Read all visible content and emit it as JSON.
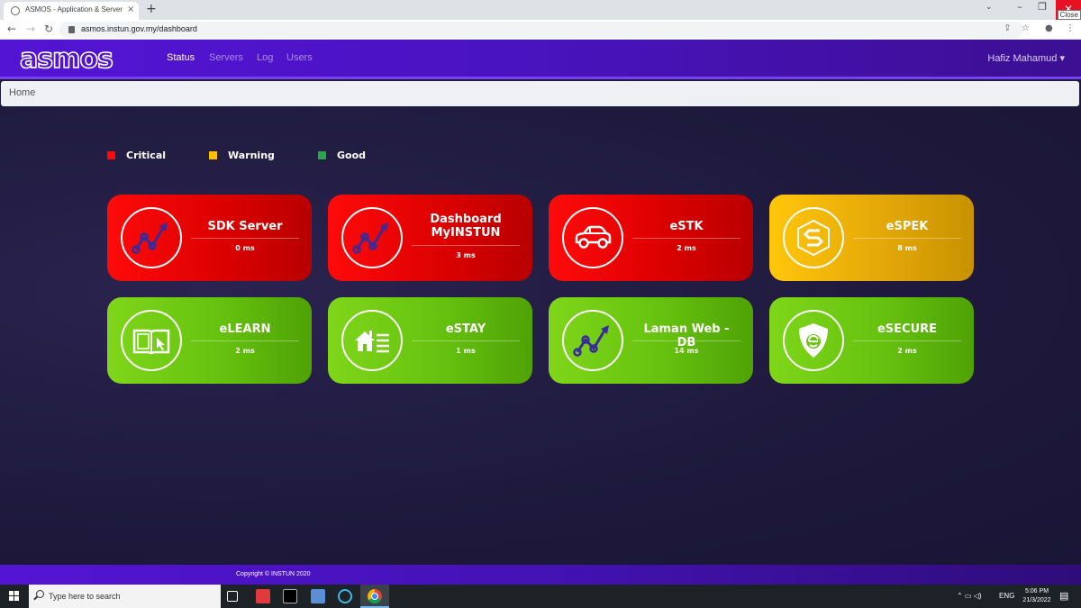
{
  "browser": {
    "tab_title": "ASMOS - Application & Server M",
    "tab_close": "×",
    "new_tab": "+",
    "url": "asmos.instun.gov.my/dashboard",
    "close_tooltip": "Close",
    "back": "←",
    "forward": "→",
    "reload": "↻",
    "minimize": "–",
    "restore": "❐",
    "close": "✕",
    "tab_list": "⌄",
    "share": "⇪",
    "star": "☆",
    "profile": "●",
    "menu": "⋮"
  },
  "navbar": {
    "logo": "asmos",
    "links": [
      "Status",
      "Servers",
      "Log",
      "Users"
    ],
    "active": "Status",
    "user": "Hafiz Mahamud ▾"
  },
  "breadcrumb": "Home",
  "legend": [
    {
      "label": "Critical",
      "color": "#ff0a0a"
    },
    {
      "label": "Warning",
      "color": "#ffbf00"
    },
    {
      "label": "Good",
      "color": "#27a745"
    }
  ],
  "cards": [
    {
      "name": "SDK Server",
      "ms": "0 ms",
      "status": "critical",
      "icon": "trend-chart-icon"
    },
    {
      "name": "Dashboard MyINSTUN",
      "ms": "3 ms",
      "status": "critical",
      "icon": "trend-chart-icon"
    },
    {
      "name": "eSTK",
      "ms": "2 ms",
      "status": "critical",
      "icon": "car-icon"
    },
    {
      "name": "eSPEK",
      "ms": "8 ms",
      "status": "warning",
      "icon": "s-hexagon-icon"
    },
    {
      "name": "eLEARN",
      "ms": "2 ms",
      "status": "good",
      "icon": "book-icon"
    },
    {
      "name": "eSTAY",
      "ms": "1 ms",
      "status": "good",
      "icon": "house-list-icon"
    },
    {
      "name": "Laman Web - DB",
      "ms": "14 ms",
      "status": "good",
      "icon": "trend-chart-icon"
    },
    {
      "name": "eSECURE",
      "ms": "2 ms",
      "status": "good",
      "icon": "shield-icon"
    }
  ],
  "footer": "Copyright © INSTUN 2020",
  "taskbar": {
    "search_placeholder": "Type here to search",
    "lang": "ENG",
    "time": "5:06 PM",
    "date": "21/3/2022",
    "tray_icons": "⌃ ▭ ◁)",
    "notification": "▤"
  }
}
